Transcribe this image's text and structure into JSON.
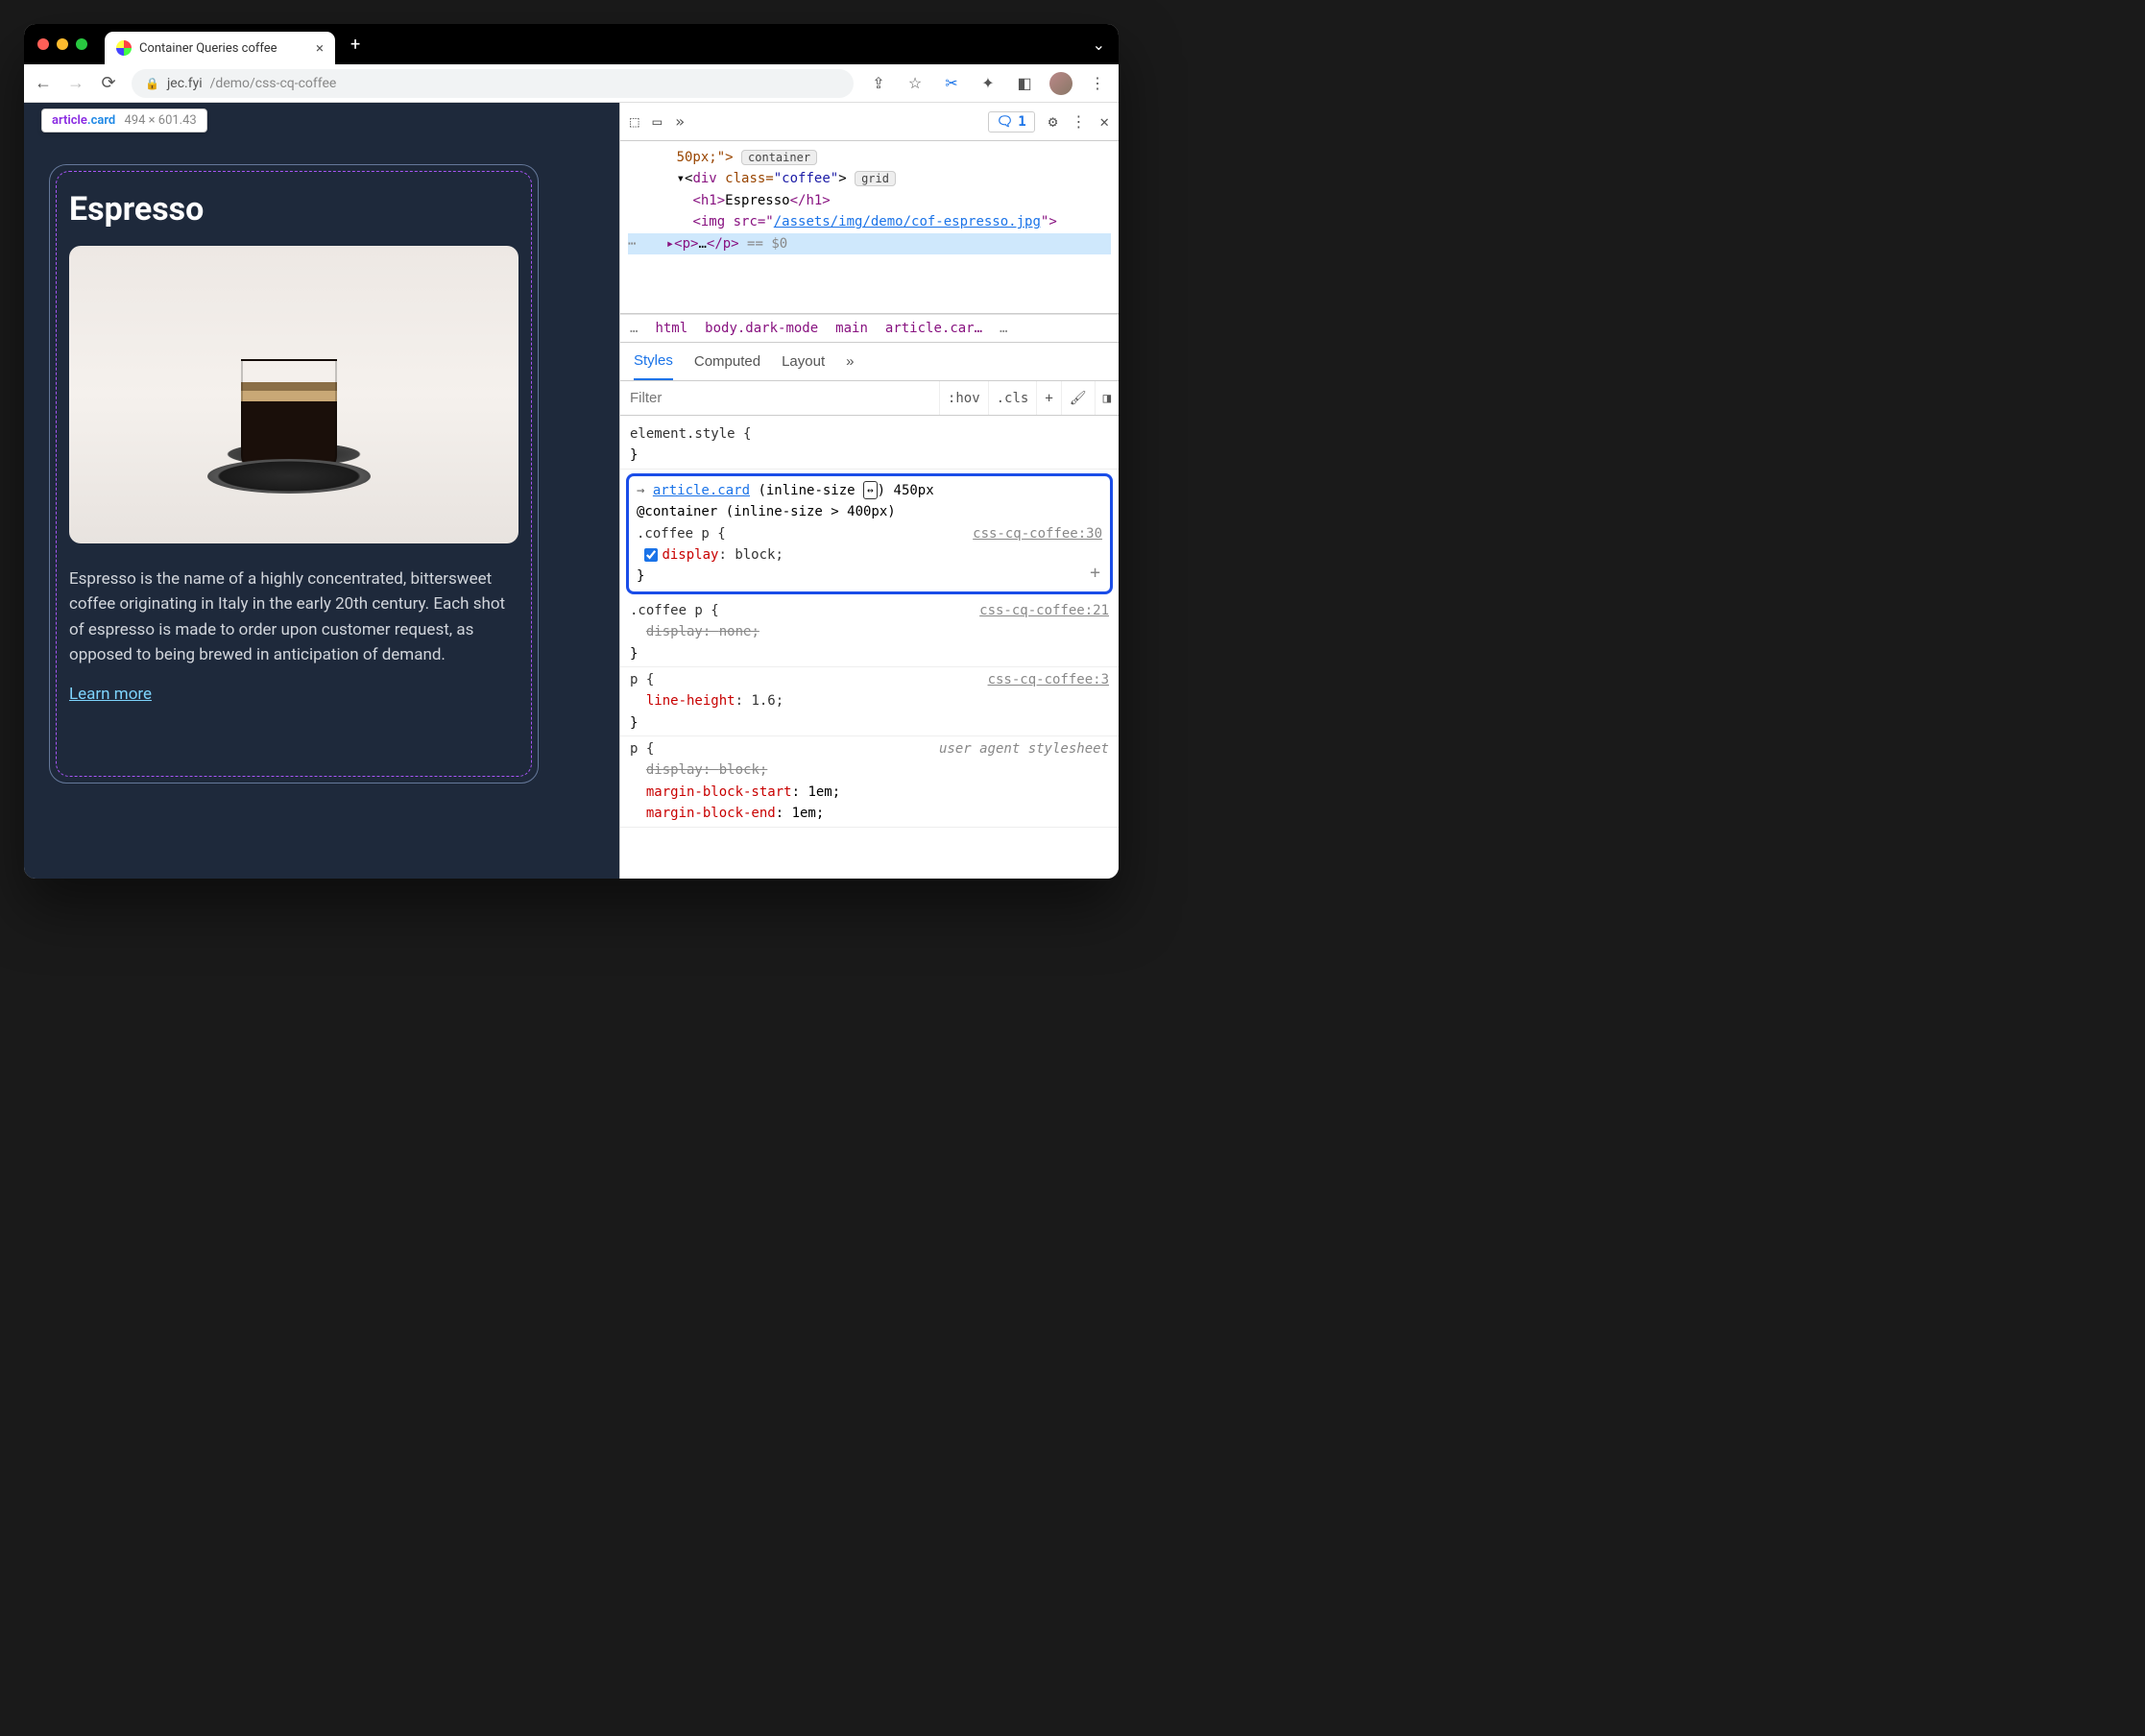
{
  "tab": {
    "title": "Container Queries coffee"
  },
  "url": {
    "host": "jec.fyi",
    "path": "/demo/css-cq-coffee"
  },
  "inspect_tooltip": {
    "selector_tag": "article",
    "selector_class": ".card",
    "dimensions": "494 × 601.43"
  },
  "card": {
    "title": "Espresso",
    "desc": "Espresso is the name of a highly concentrated, bittersweet coffee originating in Italy in the early 20th century. Each shot of espresso is made to order upon customer request, as opposed to being brewed in anticipation of demand.",
    "link_text": "Learn more"
  },
  "devtools": {
    "issues_count": "1",
    "dom": {
      "line0": "50px;\">",
      "badge0": "container",
      "div_open_prefix": "▾<",
      "div_tag": "div",
      "div_class_attr": " class=",
      "div_class_val": "\"coffee\"",
      "div_close": ">",
      "badge1": "grid",
      "h1_open": "<h1>",
      "h1_text": "Espresso",
      "h1_close": "</h1>",
      "img_open": "<img src=\"",
      "img_src": "/assets/img/demo/cof-espresso.jpg",
      "img_close": "\">",
      "p_line": "▸<p>…</p> == $0"
    },
    "breadcrumb": [
      "…",
      "html",
      "body.dark-mode",
      "main",
      "article.car…",
      "…"
    ],
    "style_tabs": [
      "Styles",
      "Computed",
      "Layout",
      "»"
    ],
    "filter_placeholder": "Filter",
    "filter_buttons": [
      ":hov",
      ".cls",
      "+"
    ],
    "rules": {
      "element_style": "element.style {",
      "cq": {
        "selector": "article.card",
        "cq_info_prefix": " (inline-size ",
        "cq_info_suffix": ") 450px",
        "at_rule": "@container (inline-size > 400px)",
        "inner_selector": ".coffee p {",
        "source": "css-cq-coffee:30",
        "prop": "display",
        "val": "block;"
      },
      "r2": {
        "selector": ".coffee p {",
        "source": "css-cq-coffee:21",
        "prop": "display",
        "val": "none;"
      },
      "r3": {
        "selector": "p {",
        "source": "css-cq-coffee:3",
        "prop": "line-height",
        "val": "1.6;"
      },
      "ua": {
        "selector": "p {",
        "label": "user agent stylesheet",
        "p1": "display",
        "v1": "block;",
        "p2": "margin-block-start",
        "v2": "1em;",
        "p3": "margin-block-end",
        "v3": "1em;"
      }
    }
  }
}
